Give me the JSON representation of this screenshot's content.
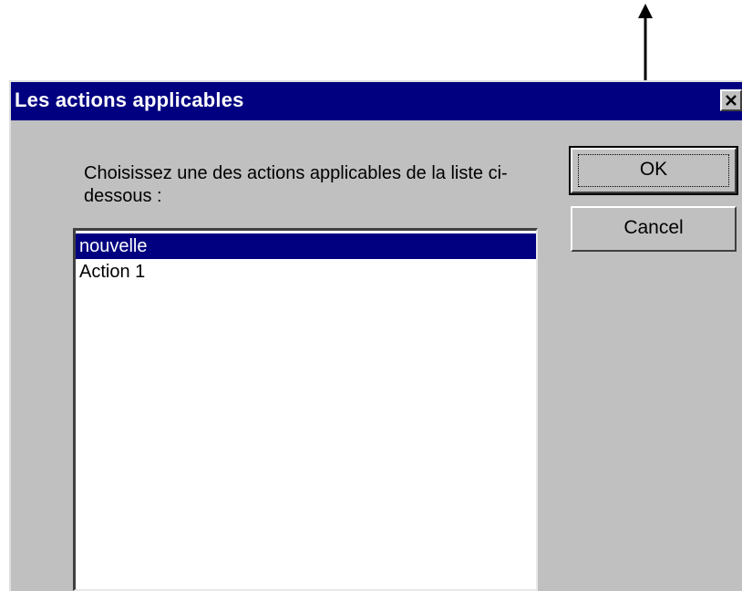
{
  "dialog": {
    "title": "Les actions applicables",
    "close_icon": "close-icon",
    "prompt": "Choisissez une des actions applicables de la liste ci-dessous :",
    "list_items": [
      {
        "label": "nouvelle",
        "selected": true
      },
      {
        "label": "Action 1",
        "selected": false
      }
    ],
    "ok_label": "OK",
    "cancel_label": "Cancel"
  },
  "colors": {
    "titlebar": "#000080",
    "face": "#c0c0c0",
    "selection": "#000080"
  },
  "annotation": {
    "icon": "up-arrow-icon"
  }
}
